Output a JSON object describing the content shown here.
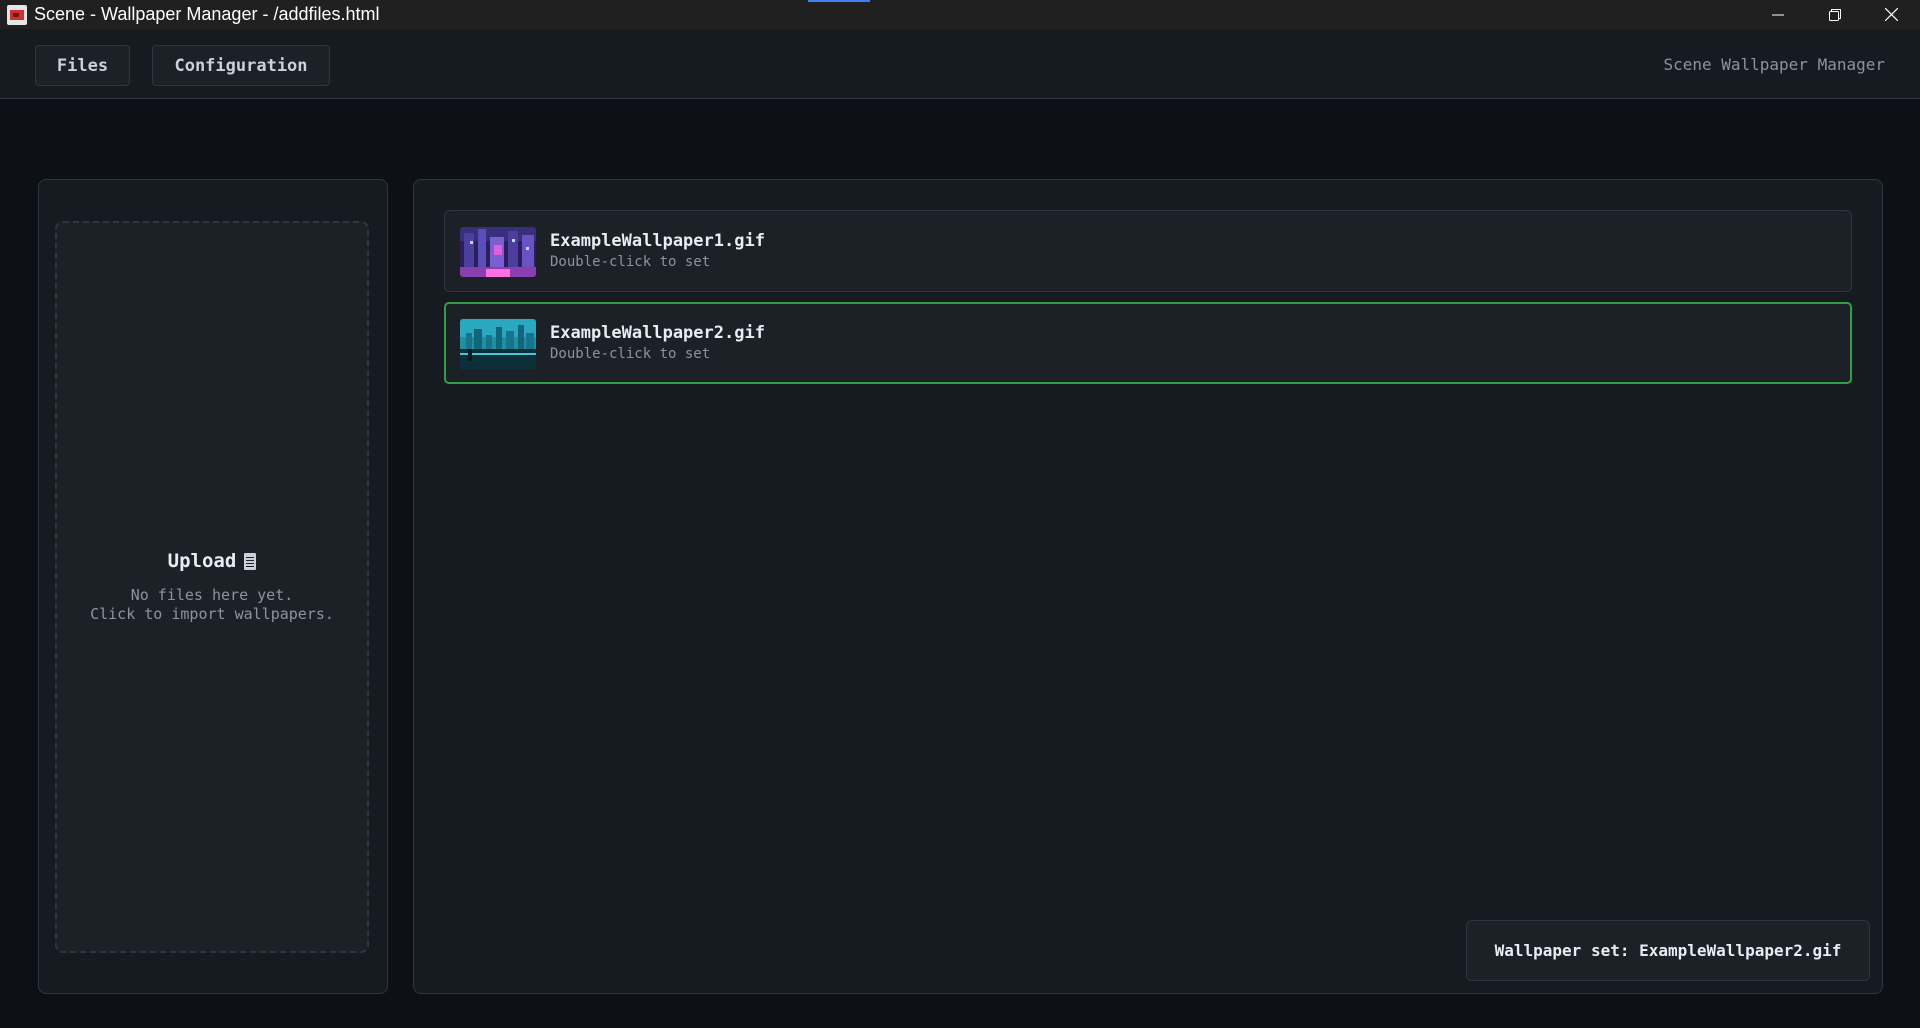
{
  "window": {
    "title": "Scene - Wallpaper Manager - /addfiles.html",
    "controls": [
      "minimize-icon",
      "restore-icon",
      "close-icon"
    ]
  },
  "header": {
    "nav": {
      "files_label": "Files",
      "configuration_label": "Configuration"
    },
    "brand": "Scene Wallpaper Manager"
  },
  "upload": {
    "title": "Upload",
    "icon": "document-icon",
    "message": "No files here yet.\nClick to import wallpapers."
  },
  "files": [
    {
      "name": "ExampleWallpaper1.gif",
      "hint": "Double-click to set",
      "selected": false
    },
    {
      "name": "ExampleWallpaper2.gif",
      "hint": "Double-click to set",
      "selected": true
    }
  ],
  "toast": {
    "message": "Wallpaper set: ExampleWallpaper2.gif"
  },
  "colors": {
    "background": "#0d1117",
    "panel": "#161b22",
    "card": "#1c2128",
    "border": "#30363d",
    "selected_border": "#2ea043",
    "muted_text": "#8b949e"
  }
}
